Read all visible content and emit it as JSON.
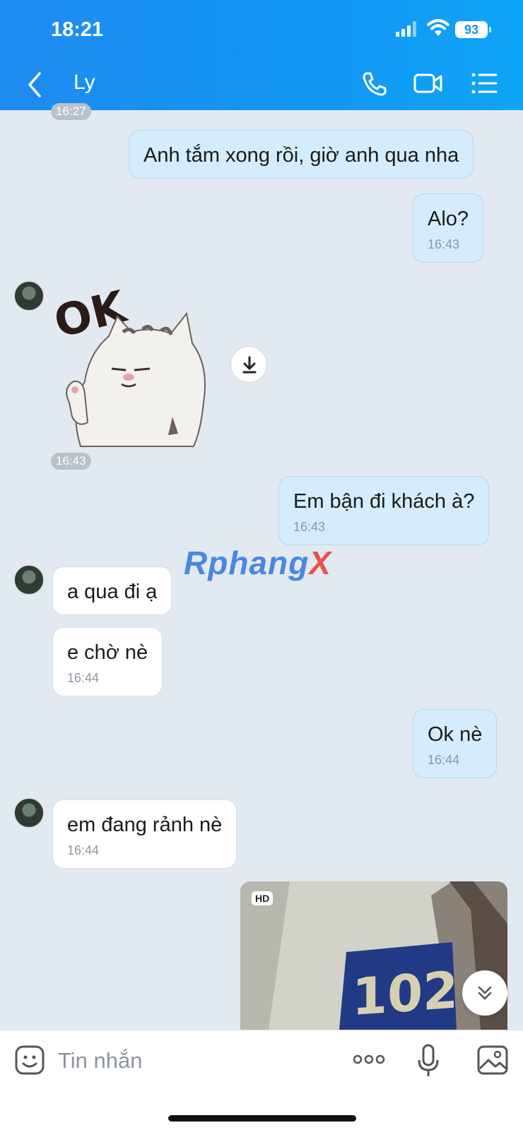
{
  "status_bar": {
    "time": "18:21",
    "battery": "93"
  },
  "header": {
    "title": "Ly",
    "icons": [
      "chevron-left-icon",
      "phone-icon",
      "video-icon",
      "list-icon"
    ]
  },
  "messages": {
    "top_time": "16:27",
    "m1": {
      "text": "Anh tắm xong rồi, giờ anh qua nha"
    },
    "m2": {
      "text": "Alo?",
      "time": "16:43"
    },
    "sticker": {
      "time": "16:43",
      "text": "OK"
    },
    "m3": {
      "text": "Em bận đi khách à?",
      "time": "16:43"
    },
    "m4": {
      "text": "a qua đi ạ"
    },
    "m5": {
      "text": "e chờ nè",
      "time": "16:44"
    },
    "m6": {
      "text": "Ok nè",
      "time": "16:44"
    },
    "m7": {
      "text": "em đang rảnh nè",
      "time": "16:44"
    },
    "photo": {
      "badge": "HD",
      "sign_text": "102"
    }
  },
  "watermark": {
    "part1": "Rphang",
    "part2": "X"
  },
  "composer": {
    "placeholder": "Tin nhắn"
  },
  "colors": {
    "header": "#1a8ff2",
    "outgoing": "#d4ecfb",
    "incoming": "#ffffff",
    "background": "#e2e9f1"
  }
}
